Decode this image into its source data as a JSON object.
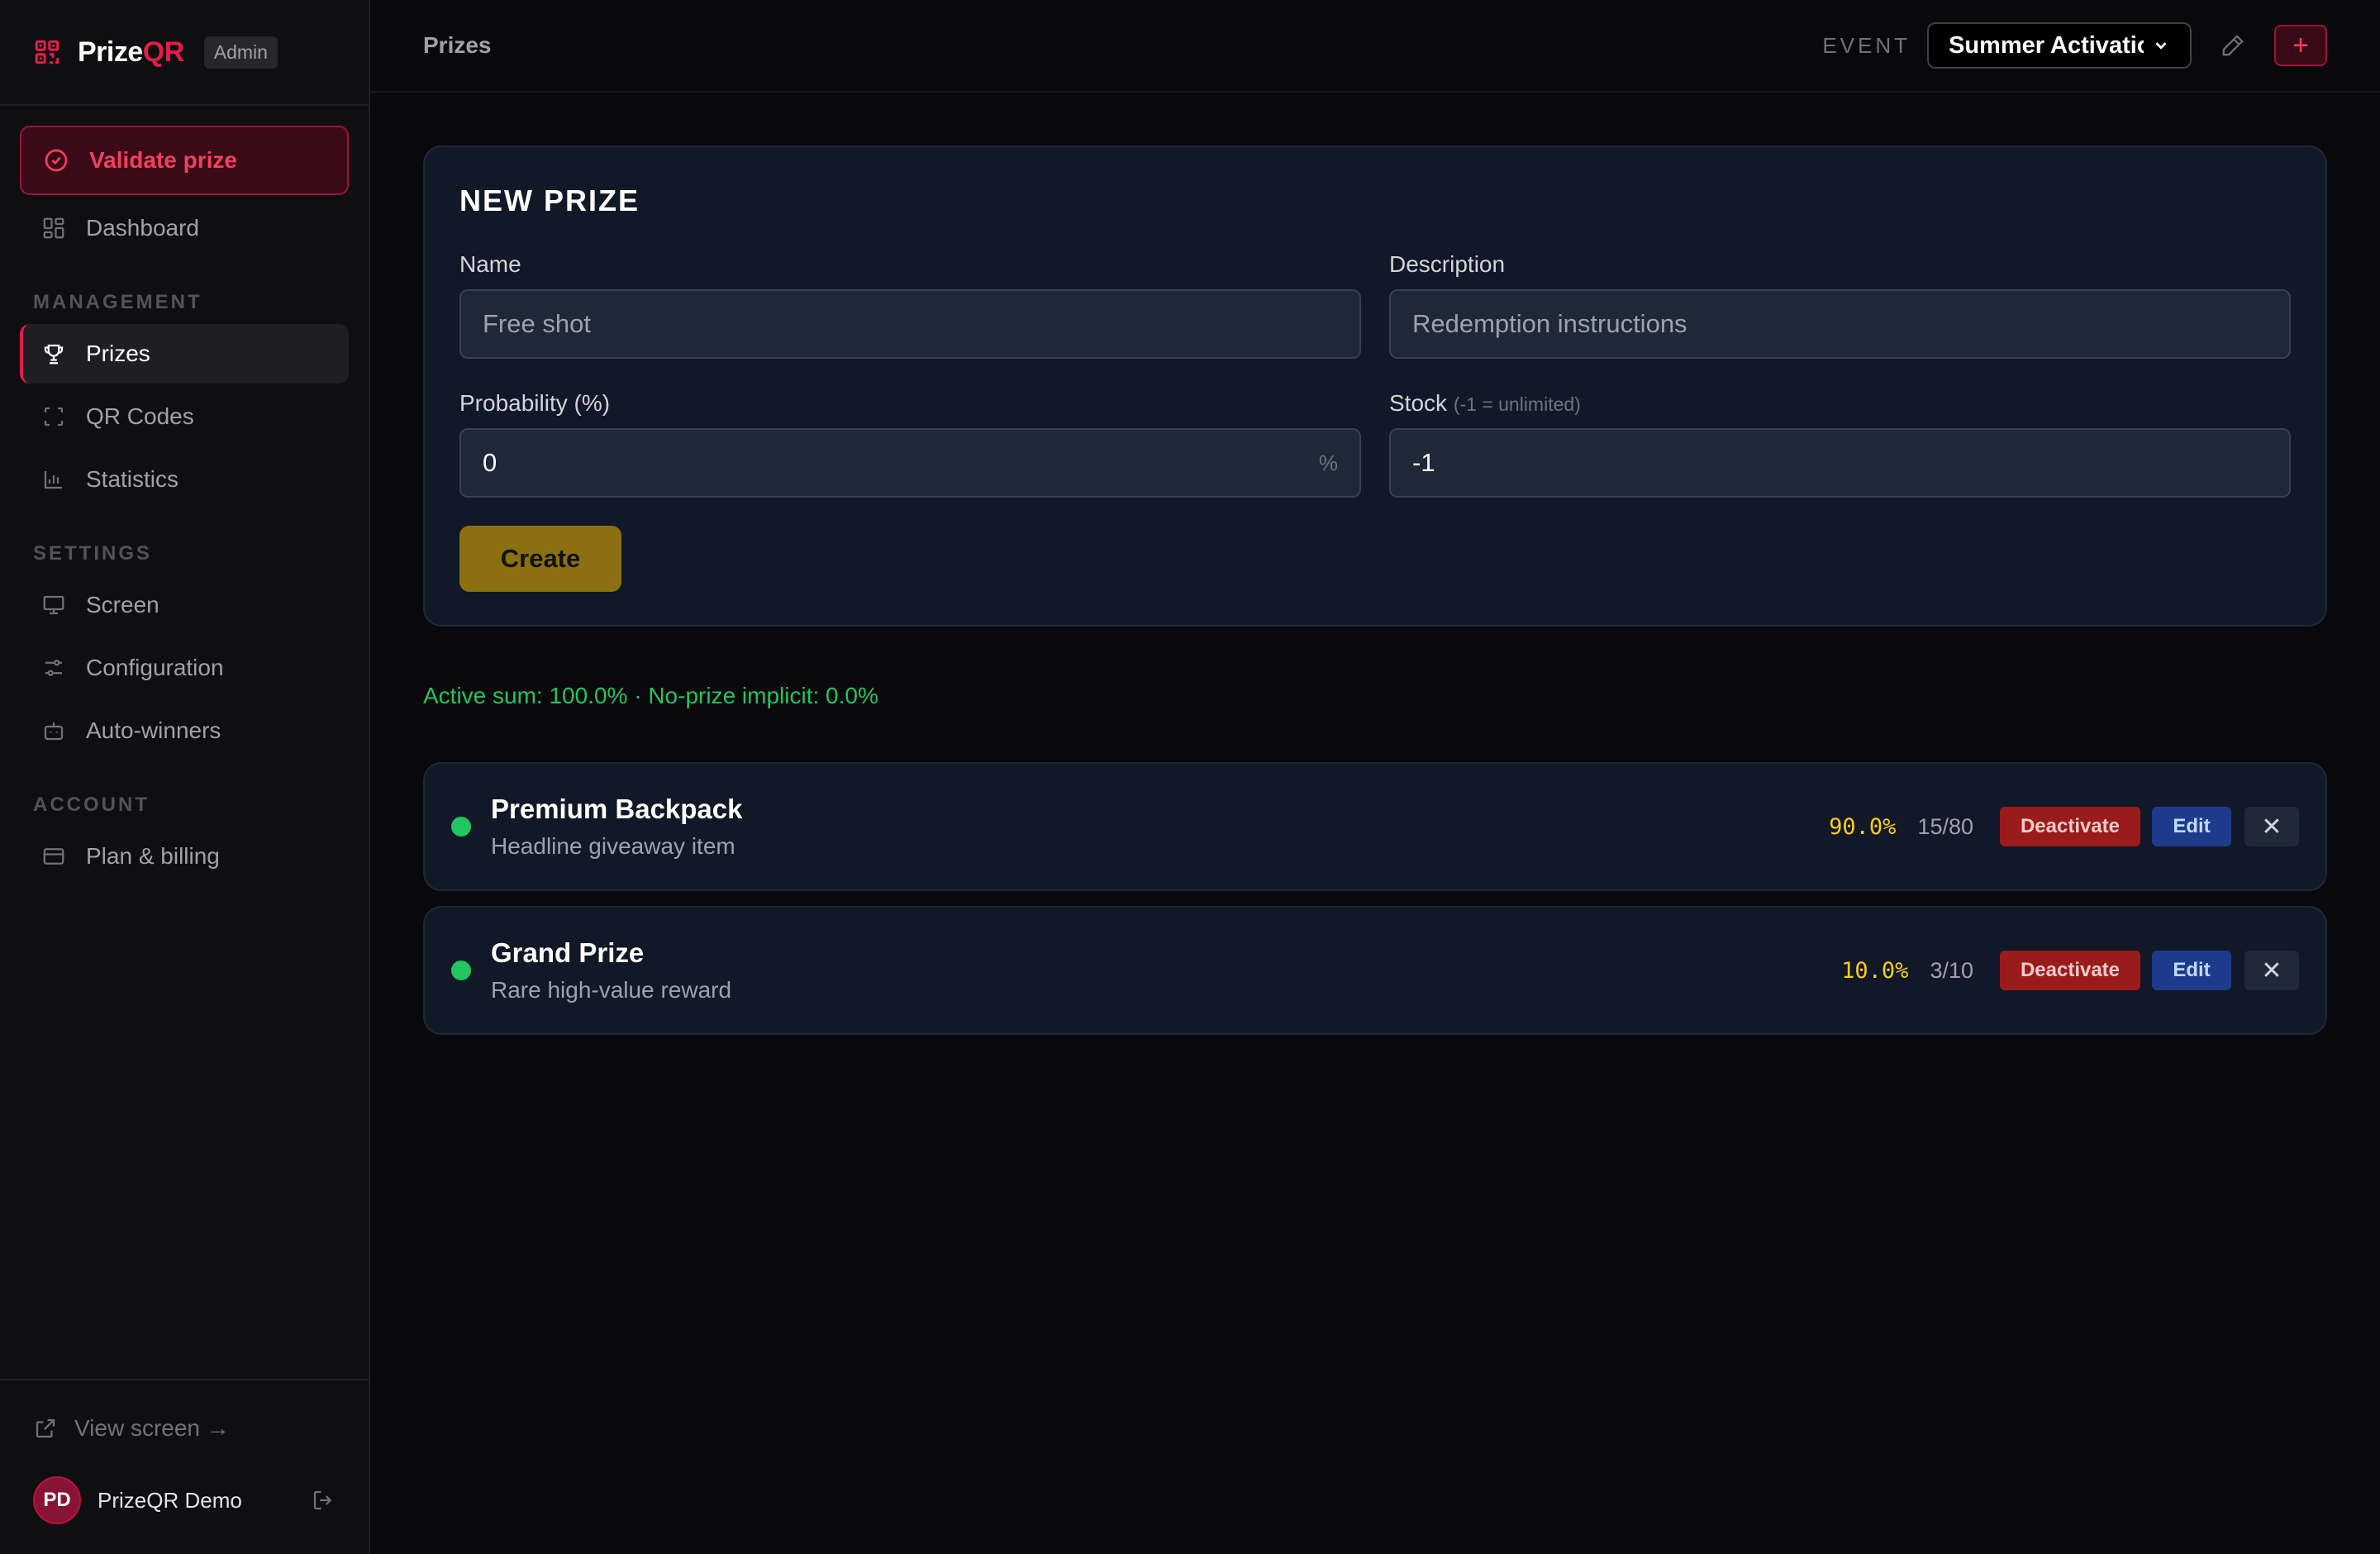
{
  "brand": {
    "name_part1": "Prize",
    "name_part2": "QR",
    "badge": "Admin"
  },
  "sidebar": {
    "validate_label": "Validate prize",
    "dashboard_label": "Dashboard",
    "sections": {
      "management": "MANAGEMENT",
      "settings": "SETTINGS",
      "account": "ACCOUNT"
    },
    "items": {
      "prizes": "Prizes",
      "qr_codes": "QR Codes",
      "statistics": "Statistics",
      "screen": "Screen",
      "configuration": "Configuration",
      "auto_winners": "Auto-winners",
      "plan_billing": "Plan & billing"
    },
    "view_screen": "View screen →",
    "user": {
      "initials": "PD",
      "name": "PrizeQR Demo"
    }
  },
  "header": {
    "title": "Prizes",
    "event_label": "EVENT",
    "event_value": "Summer Activation",
    "add_label": "+"
  },
  "form": {
    "title": "NEW PRIZE",
    "name_label": "Name",
    "name_placeholder": "Free shot",
    "description_label": "Description",
    "description_placeholder": "Redemption instructions",
    "probability_label": "Probability (%)",
    "probability_value": "0",
    "probability_unit": "%",
    "stock_label": "Stock",
    "stock_hint": "(-1 = unlimited)",
    "stock_value": "-1",
    "create_label": "Create"
  },
  "summary": "Active sum: 100.0% · No-prize implicit: 0.0%",
  "prizes": [
    {
      "name": "Premium Backpack",
      "description": "Headline giveaway item",
      "probability": "90.0%",
      "stock": "15/80",
      "deactivate_label": "Deactivate",
      "edit_label": "Edit",
      "delete_label": "✕"
    },
    {
      "name": "Grand Prize",
      "description": "Rare high-value reward",
      "probability": "10.0%",
      "stock": "3/10",
      "deactivate_label": "Deactivate",
      "edit_label": "Edit",
      "delete_label": "✕"
    }
  ],
  "colors": {
    "accent": "#e11d48",
    "active_dot": "#22c55e",
    "probability": "#facc15",
    "create_button": "#8b6f10"
  },
  "icons": {
    "brand": "qr-code-icon",
    "validate": "check-circle-icon",
    "dashboard": "grid-icon",
    "prizes": "trophy-icon",
    "qr_codes": "scan-icon",
    "statistics": "bar-chart-icon",
    "screen": "monitor-icon",
    "configuration": "sliders-icon",
    "auto_winners": "bot-icon",
    "plan_billing": "credit-card-icon",
    "view_screen": "external-link-icon",
    "logout": "logout-icon",
    "edit_event": "pencil-icon"
  }
}
